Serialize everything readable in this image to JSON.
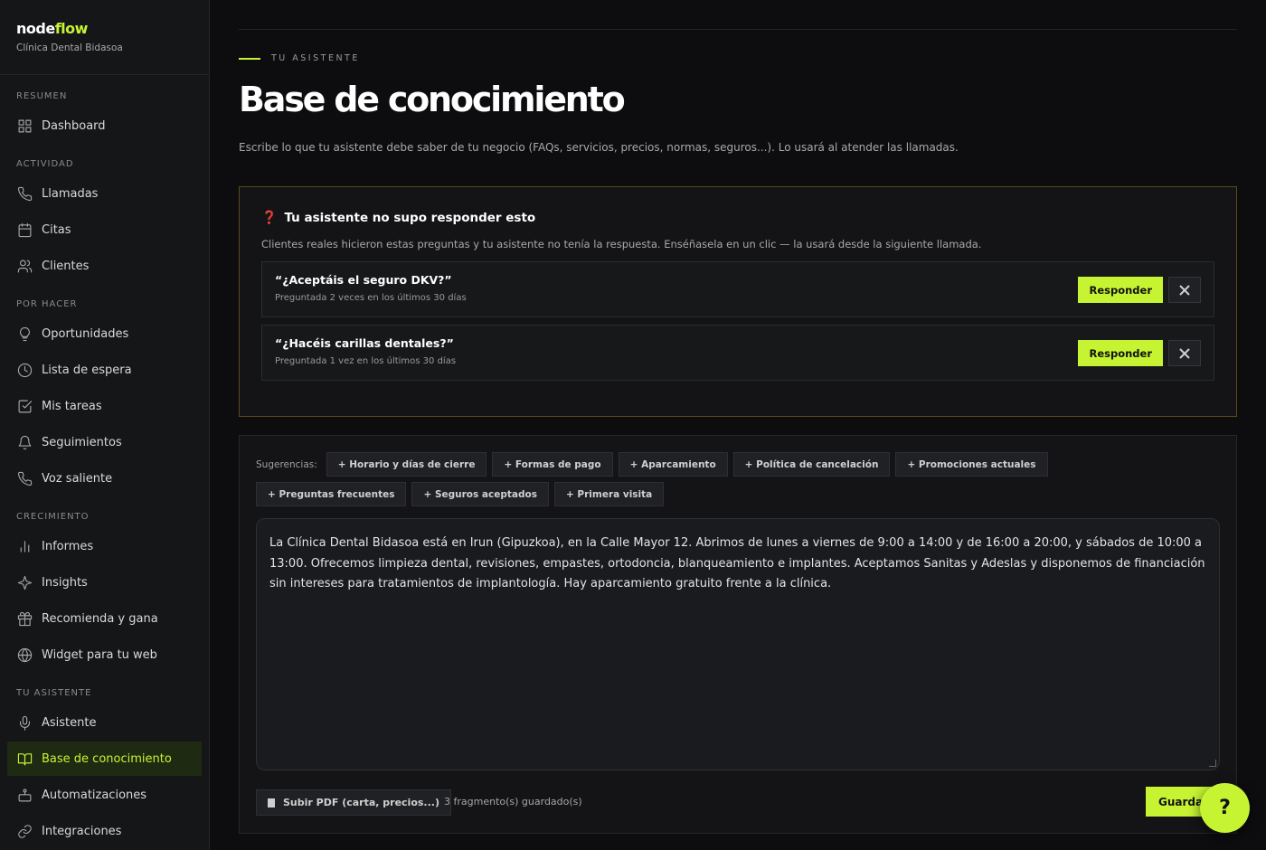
{
  "brand": {
    "name_part1": "node",
    "name_part2": "flow",
    "subtitle": "Clínica Dental Bidasoa"
  },
  "sidebar": {
    "sections": [
      {
        "label": "RESUMEN",
        "items": [
          {
            "label": "Dashboard",
            "icon": "grid-icon"
          }
        ]
      },
      {
        "label": "ACTIVIDAD",
        "items": [
          {
            "label": "Llamadas",
            "icon": "phone-icon"
          },
          {
            "label": "Citas",
            "icon": "calendar-icon"
          },
          {
            "label": "Clientes",
            "icon": "users-icon"
          }
        ]
      },
      {
        "label": "POR HACER",
        "items": [
          {
            "label": "Oportunidades",
            "icon": "lightbulb-icon"
          },
          {
            "label": "Lista de espera",
            "icon": "clock-icon"
          },
          {
            "label": "Mis tareas",
            "icon": "checkbox-icon"
          },
          {
            "label": "Seguimientos",
            "icon": "bell-icon"
          },
          {
            "label": "Voz saliente",
            "icon": "phone-outgoing-icon"
          }
        ]
      },
      {
        "label": "CRECIMIENTO",
        "items": [
          {
            "label": "Informes",
            "icon": "bar-chart-icon"
          },
          {
            "label": "Insights",
            "icon": "sparkle-icon"
          },
          {
            "label": "Recomienda y gana",
            "icon": "gift-icon"
          },
          {
            "label": "Widget para tu web",
            "icon": "globe-icon"
          }
        ]
      },
      {
        "label": "TU ASISTENTE",
        "items": [
          {
            "label": "Asistente",
            "icon": "microphone-icon"
          },
          {
            "label": "Base de conocimiento",
            "icon": "book-icon",
            "active": true
          },
          {
            "label": "Automatizaciones",
            "icon": "bot-icon"
          },
          {
            "label": "Integraciones",
            "icon": "link-icon"
          }
        ]
      }
    ]
  },
  "header": {
    "eyebrow": "TU ASISTENTE",
    "title": "Base de conocimiento",
    "description": "Escribe lo que tu asistente debe saber de tu negocio (FAQs, servicios, precios, normas, seguros...). Lo usará al atender las llamadas."
  },
  "unanswered": {
    "icon": "❓",
    "title": "Tu asistente no supo responder esto",
    "description": "Clientes reales hicieron estas preguntas y tu asistente no tenía la respuesta. Enséñasela en un clic — la usará desde la siguiente llamada.",
    "questions": [
      {
        "text": "“¿Aceptáis el seguro DKV?”",
        "meta": "Preguntada 2 veces en los últimos 30 días",
        "respond_label": "Responder"
      },
      {
        "text": "“¿Hacéis carillas dentales?”",
        "meta": "Preguntada 1 vez en los últimos 30 días",
        "respond_label": "Responder"
      }
    ]
  },
  "editor": {
    "suggestions_label": "Sugerencias:",
    "suggestions": [
      "+ Horario y días de cierre",
      "+ Formas de pago",
      "+ Aparcamiento",
      "+ Política de cancelación",
      "+ Promociones actuales",
      "+ Preguntas frecuentes",
      "+ Seguros aceptados",
      "+ Primera visita"
    ],
    "content": "La Clínica Dental Bidasoa está en Irun (Gipuzkoa), en la Calle Mayor 12. Abrimos de lunes a viernes de 9:00 a 14:00 y de 16:00 a 20:00, y sábados de 10:00 a 13:00. Ofrecemos limpieza dental, revisiones, empastes, ortodoncia, blanqueamiento e implantes. Aceptamos Sanitas y Adeslas y disponemos de financiación sin intereses para tratamientos de implantología. Hay aparcamiento gratuito frente a la clínica.",
    "upload_label": "Subir PDF (carta, precios...)",
    "fragments_status": "3 fragmento(s) guardado(s)",
    "save_label": "Guardar"
  },
  "help": {
    "label": "?"
  },
  "colors": {
    "accent": "#c6f432",
    "background": "#0d0d0f",
    "warning_border": "#5a4a1f"
  }
}
